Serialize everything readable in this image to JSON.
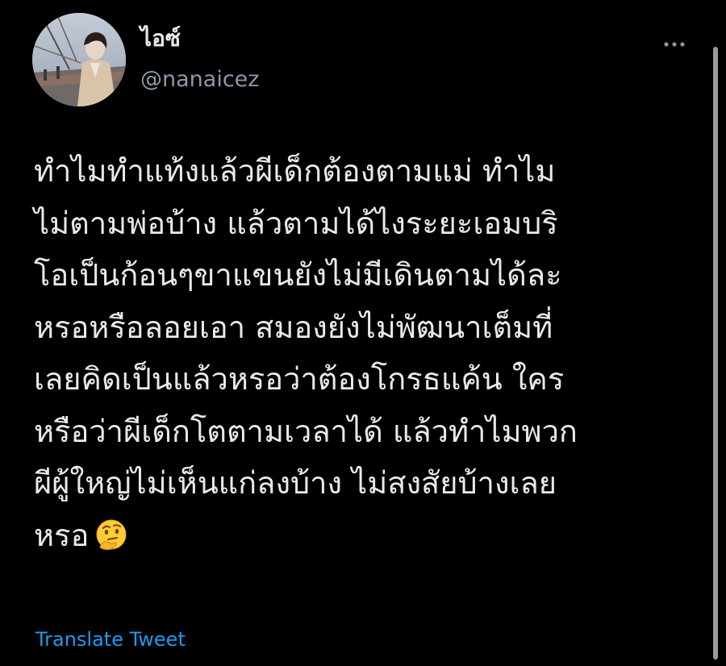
{
  "author": {
    "display_name": "ไอซ์",
    "handle": "@nanaicez",
    "avatar_icon": "profile-photo"
  },
  "tweet": {
    "lines": [
      "ทำไมทำแท้งแล้วผีเด็กต้องตามแม่ ทำไม",
      "ไม่ตามพ่อบ้าง แล้วตามได้ไงระยะเอมบริ",
      "โอเป็นก้อนๆขาแขนยังไม่มีเดินตามได้ละ",
      "หรอหรือลอยเอา สมองยังไม่พัฒนาเต็มที่",
      "เลยคิดเป็นแล้วหรอว่าต้องโกรธแค้น ใคร",
      "หรือว่าผีเด็กโตตามเวลาได้ แล้วทำไมพวก",
      "ผีผู้ใหญ่ไม่เห็นแก่ลงบ้าง ไม่สงสัยบ้างเลย",
      "หรอ"
    ],
    "emoji_icon": "thinking-face-emoji",
    "translate_label": "Translate Tweet"
  },
  "actions": {
    "more_icon": "more-options-icon"
  },
  "colors": {
    "background": "#000000",
    "text": "#e7e9ea",
    "secondary_text": "#8b98a5",
    "link": "#1d9bf0"
  }
}
